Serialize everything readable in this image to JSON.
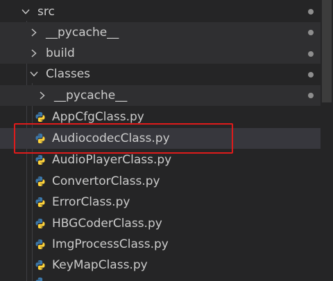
{
  "tree": {
    "src": {
      "label": "src",
      "expanded": true
    },
    "pycache_root": {
      "label": "__pycache__",
      "expanded": false
    },
    "build": {
      "label": "build",
      "expanded": false
    },
    "classes": {
      "label": "Classes",
      "expanded": true
    },
    "pycache_classes": {
      "label": "__pycache__",
      "expanded": false
    },
    "files": [
      {
        "label": "AppCfgClass.py"
      },
      {
        "label": "AudiocodecClass.py",
        "selected": true
      },
      {
        "label": "AudioPlayerClass.py"
      },
      {
        "label": "ConvertorClass.py"
      },
      {
        "label": "ErrorClass.py"
      },
      {
        "label": "HBGCoderClass.py"
      },
      {
        "label": "ImgProcessClass.py"
      },
      {
        "label": "KeyMapClass.py"
      }
    ]
  },
  "colors": {
    "background": "#252526",
    "text": "#cccccc",
    "modified_dot": "#8e8e8e",
    "highlight_border": "#e01b1b",
    "python_blue": "#3c78aa",
    "python_yellow": "#ffd43b"
  },
  "icons": {
    "folder_expanded": "chevron-down-icon",
    "folder_collapsed": "chevron-right-icon",
    "file": "python-icon"
  }
}
